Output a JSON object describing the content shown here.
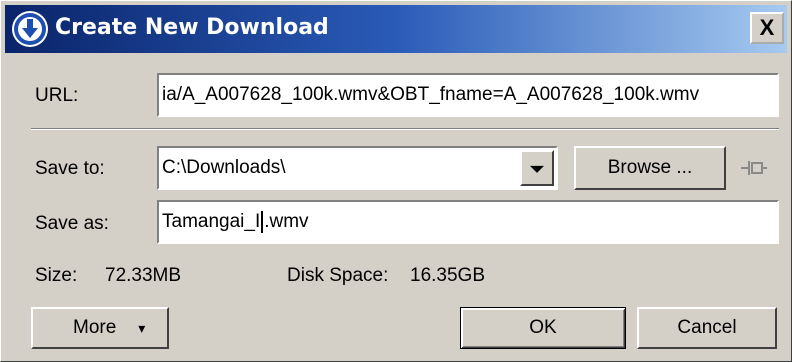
{
  "window": {
    "title": "Create New Download",
    "close_label": "X"
  },
  "url": {
    "label": "URL:",
    "value": "ia/A_A007628_100k.wmv&OBT_fname=A_A007628_100k.wmv"
  },
  "save_to": {
    "label": "Save to:",
    "value": "C:\\Downloads\\",
    "browse_label": "Browse ..."
  },
  "save_as": {
    "label": "Save as:",
    "value_before_caret": "Tamangai_I",
    "value_after_caret": ".wmv"
  },
  "info": {
    "size_label": "Size:",
    "size_value": "72.33MB",
    "disk_label": "Disk Space:",
    "disk_value": "16.35GB"
  },
  "buttons": {
    "more": "More",
    "more_arrow": "▾",
    "ok": "OK",
    "cancel": "Cancel"
  },
  "colors": {
    "titlebar_start": "#0a246a",
    "titlebar_end": "#a6caf0",
    "dialog_bg": "#d4d0c8"
  }
}
